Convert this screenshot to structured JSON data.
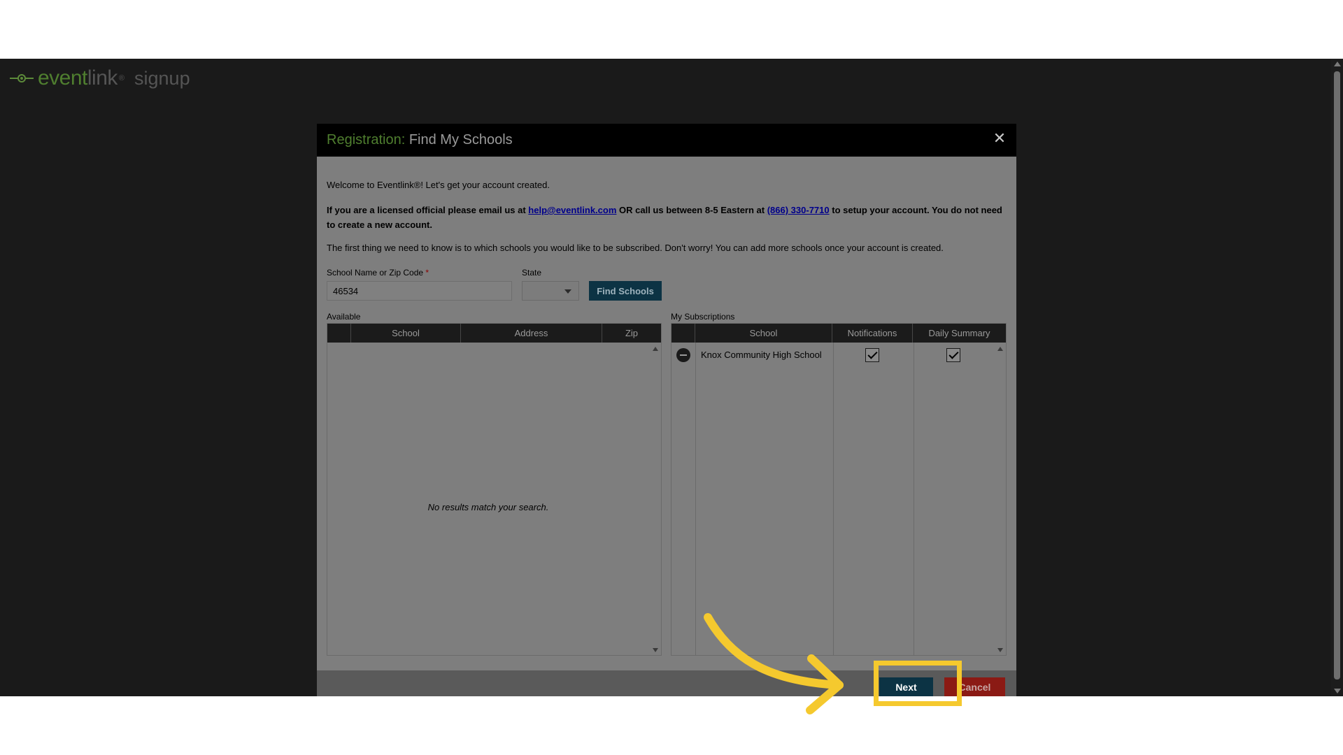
{
  "brand": {
    "word_event": "event",
    "word_link": "link",
    "registered": "®",
    "word_signup": "signup",
    "logo_color": "#4f7e2f"
  },
  "modal": {
    "title_prefix": "Registration:",
    "title_main": "Find My Schools",
    "close_icon": "close-icon",
    "welcome": "Welcome to Eventlink®! Let's get your account created.",
    "official_part1": "If you are a licensed official please email us at ",
    "official_email": "help@eventlink.com",
    "official_part2": " OR call us between 8-5 Eastern at ",
    "official_phone": "(866) 330-7710",
    "official_part3": " to setup your account. You do not need to create a new account.",
    "first_thing": "The first thing we need to know is to which schools you would like to be subscribed. Don't worry! You can add more schools once your account is created."
  },
  "search": {
    "zip_label": "School Name or Zip Code",
    "required_mark": "*",
    "zip_value": "46534",
    "state_label": "State",
    "state_value": "",
    "find_button": "Find Schools"
  },
  "available": {
    "label": "Available",
    "columns": [
      "",
      "School",
      "Address",
      "Zip"
    ],
    "empty_message": "No results match your search."
  },
  "subscriptions": {
    "label": "My Subscriptions",
    "columns": [
      "",
      "School",
      "Notifications",
      "Daily Summary"
    ],
    "rows": [
      {
        "school": "Knox Community High School",
        "notifications": true,
        "daily_summary": true
      }
    ]
  },
  "footer": {
    "next_label": "Next",
    "cancel_label": "Cancel"
  },
  "annotation": {
    "highlight_color": "#f5c92e"
  }
}
